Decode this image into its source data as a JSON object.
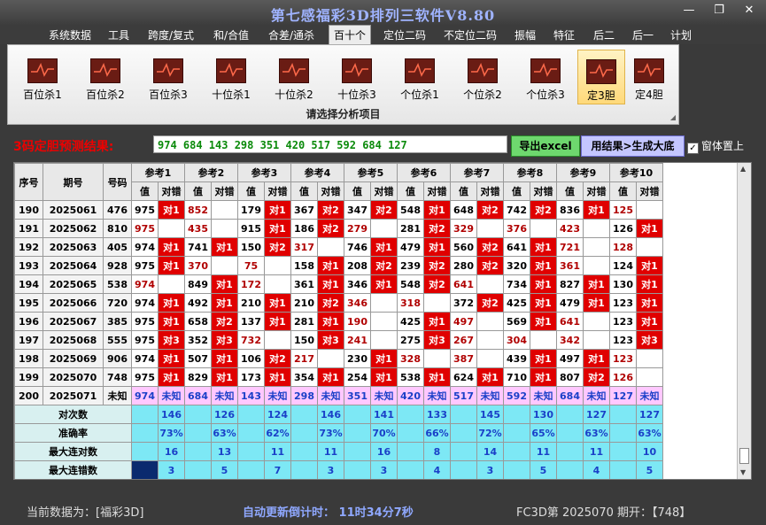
{
  "app": {
    "title": "第七感福彩3D排列三软件V8.80"
  },
  "window_controls": {
    "minimize": "—",
    "restore": "❐",
    "close": "✕"
  },
  "menu": [
    {
      "label": "系统数据"
    },
    {
      "label": "工具"
    },
    {
      "label": "跨度/复式"
    },
    {
      "label": "和/合值"
    },
    {
      "label": "合差/通杀"
    },
    {
      "label": "百十个"
    },
    {
      "label": "定位二码"
    },
    {
      "label": "不定位二码"
    },
    {
      "label": "振幅"
    },
    {
      "label": "特征"
    },
    {
      "label": "后二"
    },
    {
      "label": "后一"
    },
    {
      "label": "计划"
    }
  ],
  "ribbon": {
    "caption": "请选择分析项目",
    "buttons": [
      {
        "label": "百位杀1"
      },
      {
        "label": "百位杀2"
      },
      {
        "label": "百位杀3"
      },
      {
        "label": "十位杀1"
      },
      {
        "label": "十位杀2"
      },
      {
        "label": "十位杀3"
      },
      {
        "label": "个位杀1"
      },
      {
        "label": "个位杀2"
      },
      {
        "label": "个位杀3"
      },
      {
        "label": "定3胆"
      },
      {
        "label": "定4胆"
      }
    ]
  },
  "prediction": {
    "label": "3码定胆预测结果:",
    "result": "974 684 143 298 351 420 517 592 684 127",
    "excel_button": "导出excel",
    "fill_button": "用结果>生成大底",
    "checkbox_label": "窗体置上",
    "checkbox_checked": "✓"
  },
  "table": {
    "head": {
      "seq": "序号",
      "period": "期号",
      "number": "号码",
      "value": "值",
      "hit": "对错"
    },
    "refs": [
      "参考1",
      "参考2",
      "参考3",
      "参考4",
      "参考5",
      "参考6",
      "参考7",
      "参考8",
      "参考9",
      "参考10"
    ],
    "rows": [
      {
        "seq": "190",
        "period": "2025061",
        "num": "476",
        "cells": [
          [
            "975",
            "对1"
          ],
          [
            "852",
            ""
          ],
          [
            "179",
            "对1"
          ],
          [
            "367",
            "对2"
          ],
          [
            "347",
            "对2"
          ],
          [
            "548",
            "对1"
          ],
          [
            "648",
            "对2"
          ],
          [
            "742",
            "对2"
          ],
          [
            "836",
            "对1"
          ],
          [
            "125",
            ""
          ]
        ]
      },
      {
        "seq": "191",
        "period": "2025062",
        "num": "810",
        "cells": [
          [
            "975",
            ""
          ],
          [
            "435",
            ""
          ],
          [
            "915",
            "对1"
          ],
          [
            "186",
            "对2"
          ],
          [
            "279",
            ""
          ],
          [
            "281",
            "对2"
          ],
          [
            "329",
            ""
          ],
          [
            "376",
            ""
          ],
          [
            "423",
            ""
          ],
          [
            "126",
            "对1"
          ]
        ]
      },
      {
        "seq": "192",
        "period": "2025063",
        "num": "405",
        "cells": [
          [
            "974",
            "对1"
          ],
          [
            "741",
            "对1"
          ],
          [
            "150",
            "对2"
          ],
          [
            "317",
            ""
          ],
          [
            "746",
            "对1"
          ],
          [
            "479",
            "对1"
          ],
          [
            "560",
            "对2"
          ],
          [
            "641",
            "对1"
          ],
          [
            "721",
            ""
          ],
          [
            "128",
            ""
          ]
        ]
      },
      {
        "seq": "193",
        "period": "2025064",
        "num": "928",
        "cells": [
          [
            "975",
            "对1"
          ],
          [
            "370",
            ""
          ],
          [
            "75",
            ""
          ],
          [
            "158",
            "对1"
          ],
          [
            "208",
            "对2"
          ],
          [
            "239",
            "对2"
          ],
          [
            "280",
            "对2"
          ],
          [
            "320",
            "对1"
          ],
          [
            "361",
            ""
          ],
          [
            "124",
            "对1"
          ]
        ]
      },
      {
        "seq": "194",
        "period": "2025065",
        "num": "538",
        "cells": [
          [
            "974",
            ""
          ],
          [
            "849",
            "对1"
          ],
          [
            "172",
            ""
          ],
          [
            "361",
            "对1"
          ],
          [
            "346",
            "对1"
          ],
          [
            "548",
            "对2"
          ],
          [
            "641",
            ""
          ],
          [
            "734",
            "对1"
          ],
          [
            "827",
            "对1"
          ],
          [
            "130",
            "对1"
          ]
        ]
      },
      {
        "seq": "195",
        "period": "2025066",
        "num": "720",
        "cells": [
          [
            "974",
            "对1"
          ],
          [
            "492",
            "对1"
          ],
          [
            "210",
            "对1"
          ],
          [
            "210",
            "对2"
          ],
          [
            "346",
            ""
          ],
          [
            "318",
            ""
          ],
          [
            "372",
            "对2"
          ],
          [
            "425",
            "对1"
          ],
          [
            "479",
            "对1"
          ],
          [
            "123",
            "对1"
          ]
        ]
      },
      {
        "seq": "196",
        "period": "2025067",
        "num": "385",
        "cells": [
          [
            "975",
            "对1"
          ],
          [
            "658",
            "对2"
          ],
          [
            "137",
            "对1"
          ],
          [
            "281",
            "对1"
          ],
          [
            "190",
            ""
          ],
          [
            "425",
            "对1"
          ],
          [
            "497",
            ""
          ],
          [
            "569",
            "对1"
          ],
          [
            "641",
            ""
          ],
          [
            "123",
            "对1"
          ]
        ]
      },
      {
        "seq": "197",
        "period": "2025068",
        "num": "555",
        "cells": [
          [
            "975",
            "对3"
          ],
          [
            "352",
            "对3"
          ],
          [
            "732",
            ""
          ],
          [
            "150",
            "对3"
          ],
          [
            "241",
            ""
          ],
          [
            "275",
            "对3"
          ],
          [
            "267",
            ""
          ],
          [
            "304",
            ""
          ],
          [
            "342",
            ""
          ],
          [
            "123",
            "对3"
          ]
        ]
      },
      {
        "seq": "198",
        "period": "2025069",
        "num": "906",
        "cells": [
          [
            "974",
            "对1"
          ],
          [
            "507",
            "对1"
          ],
          [
            "106",
            "对2"
          ],
          [
            "217",
            ""
          ],
          [
            "230",
            "对1"
          ],
          [
            "328",
            ""
          ],
          [
            "387",
            ""
          ],
          [
            "439",
            "对1"
          ],
          [
            "497",
            "对1"
          ],
          [
            "123",
            ""
          ]
        ]
      },
      {
        "seq": "199",
        "period": "2025070",
        "num": "748",
        "cells": [
          [
            "975",
            "对1"
          ],
          [
            "829",
            "对1"
          ],
          [
            "173",
            "对1"
          ],
          [
            "354",
            "对1"
          ],
          [
            "254",
            "对1"
          ],
          [
            "538",
            "对1"
          ],
          [
            "624",
            "对1"
          ],
          [
            "710",
            "对1"
          ],
          [
            "807",
            "对2"
          ],
          [
            "126",
            ""
          ]
        ]
      }
    ],
    "predict_row": {
      "seq": "200",
      "period": "2025071",
      "num": "未知",
      "cells": [
        [
          "974",
          "未知"
        ],
        [
          "684",
          "未知"
        ],
        [
          "143",
          "未知"
        ],
        [
          "298",
          "未知"
        ],
        [
          "351",
          "未知"
        ],
        [
          "420",
          "未知"
        ],
        [
          "517",
          "未知"
        ],
        [
          "592",
          "未知"
        ],
        [
          "684",
          "未知"
        ],
        [
          "127",
          "未知"
        ]
      ]
    },
    "stats": [
      {
        "label": "对次数",
        "values": [
          "146",
          "126",
          "124",
          "146",
          "141",
          "133",
          "145",
          "130",
          "127",
          "127"
        ]
      },
      {
        "label": "准确率",
        "values": [
          "73%",
          "63%",
          "62%",
          "73%",
          "70%",
          "66%",
          "72%",
          "65%",
          "63%",
          "63%"
        ]
      },
      {
        "label": "最大连对数",
        "values": [
          "16",
          "13",
          "11",
          "11",
          "16",
          "8",
          "14",
          "11",
          "11",
          "10"
        ]
      },
      {
        "label": "最大连错数",
        "values": [
          "3",
          "5",
          "7",
          "3",
          "3",
          "4",
          "3",
          "5",
          "4",
          "5"
        ]
      }
    ]
  },
  "status": {
    "current": "当前数据为：[福彩3D]",
    "countdown": "自动更新倒计时：  11时34分7秒",
    "issue": "FC3D第 2025070 期开：【748】"
  },
  "colors": {
    "hit": "#e00000",
    "predict": "#ffc8ff",
    "stat": "#7de8f5",
    "title": "#9fb3ff"
  }
}
